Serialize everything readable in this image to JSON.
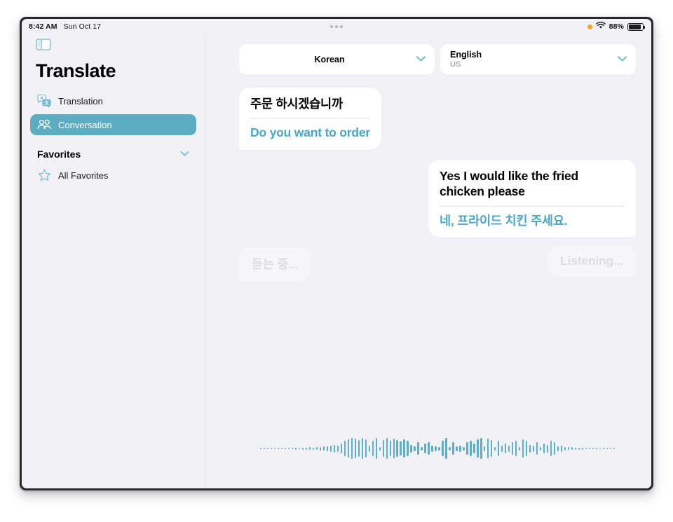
{
  "status_bar": {
    "time": "8:42 AM",
    "date": "Sun Oct 17",
    "battery_percent": "88%",
    "battery_level": 88,
    "recording_indicator": "orange-dot",
    "wifi_icon": "wifi-icon",
    "multitask_icon": "three-dots-icon"
  },
  "sidebar": {
    "toggle_icon": "sidebar-toggle-icon",
    "title": "Translate",
    "items": [
      {
        "label": "Translation",
        "icon": "translation-bubbles-icon",
        "selected": false
      },
      {
        "label": "Conversation",
        "icon": "two-people-icon",
        "selected": true
      }
    ],
    "favorites": {
      "title": "Favorites",
      "chevron_icon": "chevron-down-icon",
      "items": [
        {
          "label": "All Favorites",
          "icon": "star-icon"
        }
      ]
    }
  },
  "main": {
    "language_selectors": [
      {
        "name": "Korean",
        "sub": "",
        "chevron_icon": "chevron-down-icon",
        "centered": true
      },
      {
        "name": "English",
        "sub": "US",
        "chevron_icon": "chevron-down-icon",
        "centered": false
      }
    ],
    "messages": [
      {
        "side": "left",
        "source": "주문 하시겠습니까",
        "translation": "Do you want to order"
      },
      {
        "side": "right",
        "source": "Yes I would like the fried chicken please",
        "translation": "네, 프라이드 치킨 주세요."
      }
    ],
    "listening_placeholders": [
      {
        "side": "left",
        "text": "듣는 중..."
      },
      {
        "side": "right",
        "text": "Listening..."
      }
    ],
    "waveform": {
      "name": "audio-waveform",
      "color": "#5cafcb",
      "bars": [
        1,
        1,
        1,
        1,
        2,
        2,
        1,
        2,
        2,
        2,
        3,
        2,
        3,
        3,
        4,
        3,
        4,
        5,
        6,
        7,
        9,
        11,
        9,
        14,
        22,
        26,
        30,
        28,
        24,
        30,
        26,
        9,
        22,
        30,
        5,
        24,
        30,
        22,
        28,
        24,
        20,
        26,
        22,
        11,
        7,
        18,
        5,
        14,
        18,
        9,
        7,
        5,
        22,
        30,
        5,
        18,
        7,
        9,
        5,
        18,
        22,
        14,
        26,
        30,
        7,
        28,
        24,
        5,
        22,
        9,
        14,
        9,
        18,
        22,
        5,
        26,
        22,
        11,
        9,
        18,
        5,
        14,
        11,
        22,
        18,
        7,
        9,
        5,
        4,
        4,
        3,
        3,
        3,
        2,
        2,
        2,
        2,
        1,
        1,
        1,
        1,
        1
      ]
    }
  },
  "colors": {
    "accent": "#5dadc2",
    "translation_text": "#4aa6c4",
    "sidebar_bg": "#f2f2f6",
    "bubble_bg": "#ffffff",
    "placeholder_text": "#dcdce1"
  }
}
